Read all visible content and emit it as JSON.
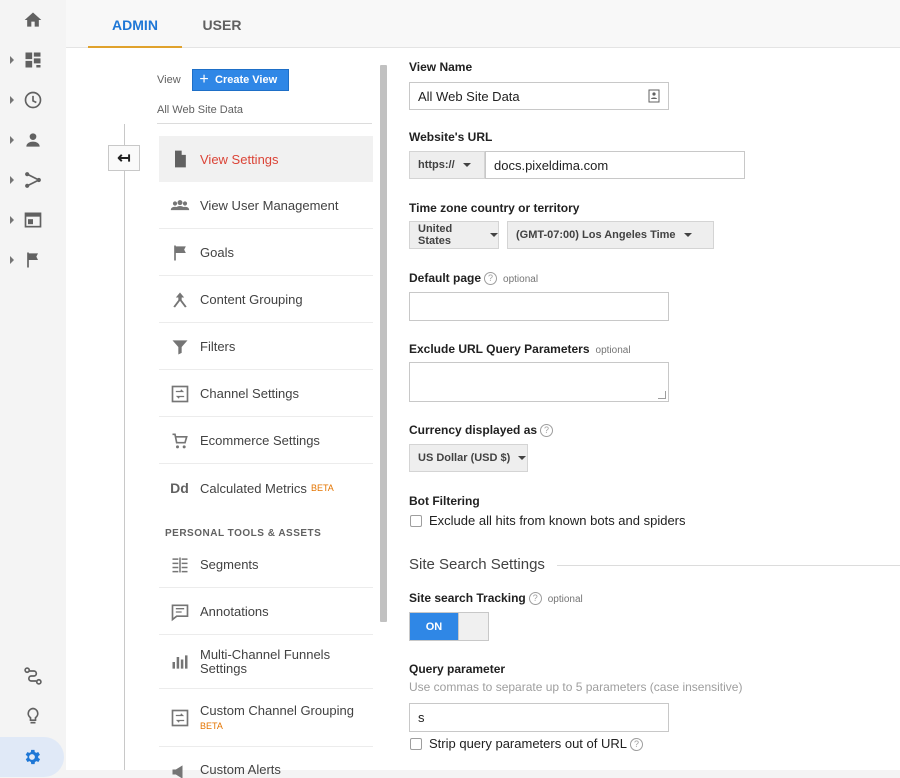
{
  "top_tabs": [
    {
      "label": "ADMIN",
      "active": true
    },
    {
      "label": "USER",
      "active": false
    }
  ],
  "rail": {
    "items": [
      "home-icon",
      "dashboard-icon",
      "clock-icon",
      "person-icon",
      "acquisition-icon",
      "behavior-icon",
      "flag-icon"
    ],
    "bottom": [
      "attribution-icon",
      "lightbulb-icon",
      "gear-icon"
    ]
  },
  "admin_nav": {
    "view_label": "View",
    "create_view_label": "Create View",
    "view_name": "All Web Site Data",
    "items": [
      {
        "label": "View Settings",
        "icon": "document-icon",
        "active": true
      },
      {
        "label": "View User Management",
        "icon": "people-icon"
      },
      {
        "label": "Goals",
        "icon": "flag-icon"
      },
      {
        "label": "Content Grouping",
        "icon": "merge-icon"
      },
      {
        "label": "Filters",
        "icon": "filter-icon"
      },
      {
        "label": "Channel Settings",
        "icon": "channel-icon"
      },
      {
        "label": "Ecommerce Settings",
        "icon": "cart-icon"
      },
      {
        "label": "Calculated Metrics",
        "badge": "BETA",
        "icon": "dd-icon"
      }
    ],
    "section_title": "PERSONAL TOOLS & ASSETS",
    "personal_items": [
      {
        "label": "Segments",
        "icon": "segments-icon"
      },
      {
        "label": "Annotations",
        "icon": "annotation-icon"
      },
      {
        "label_line1": "Multi-Channel Funnels",
        "label_line2": "Settings",
        "icon": "bar-chart-icon"
      },
      {
        "label": "Custom Channel Grouping",
        "badge": "BETA",
        "icon": "channel-icon"
      },
      {
        "label": "Custom Alerts",
        "icon": "megaphone-icon"
      }
    ]
  },
  "form": {
    "view_name": {
      "label": "View Name",
      "value": "All Web Site Data"
    },
    "website_url": {
      "label": "Website's URL",
      "protocol": "https://",
      "value": "docs.pixeldima.com"
    },
    "timezone": {
      "label": "Time zone country or territory",
      "country": "United States",
      "zone": "(GMT-07:00) Los Angeles Time"
    },
    "default_page": {
      "label": "Default page",
      "optional": "optional",
      "value": ""
    },
    "exclude_params": {
      "label": "Exclude URL Query Parameters",
      "optional": "optional",
      "value": ""
    },
    "currency": {
      "label": "Currency displayed as",
      "value": "US Dollar (USD $)"
    },
    "bot_filtering": {
      "label": "Bot Filtering",
      "checkbox_label": "Exclude all hits from known bots and spiders",
      "checked": false
    },
    "site_search_heading": "Site Search Settings",
    "site_search_tracking": {
      "label": "Site search Tracking",
      "optional": "optional",
      "state": "ON"
    },
    "query_param": {
      "label": "Query parameter",
      "hint": "Use commas to separate up to 5 parameters (case insensitive)",
      "value": "s"
    },
    "strip_params": {
      "label": "Strip query parameters out of URL",
      "checked": false
    }
  },
  "colors": {
    "accent": "#1e77d6",
    "active_nav": "#db4437",
    "tab_underline": "#e0a22c",
    "beta": "#e37400"
  }
}
